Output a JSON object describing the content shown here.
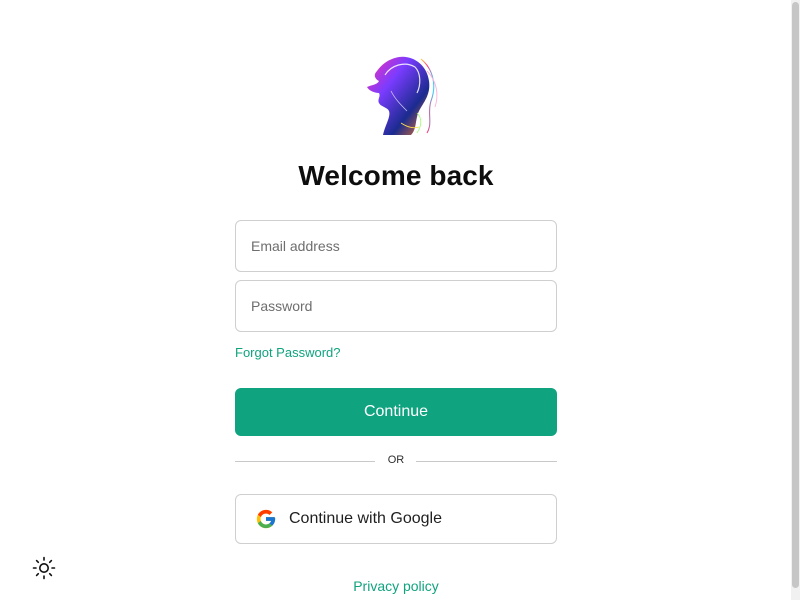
{
  "heading": {
    "title": "Welcome back"
  },
  "form": {
    "email_placeholder": "Email address",
    "password_placeholder": "Password",
    "forgot_password": "Forgot Password?",
    "continue_label": "Continue"
  },
  "divider": {
    "label": "OR"
  },
  "social": {
    "google_label": "Continue with Google"
  },
  "footer": {
    "privacy_label": "Privacy policy"
  },
  "icons": {
    "logo": "abstract-face-logo",
    "google": "google-g-icon",
    "theme_toggle": "sun-icon"
  },
  "colors": {
    "accent": "#10a37f",
    "border": "#cfcfcf",
    "text": "#0d0d0d"
  }
}
